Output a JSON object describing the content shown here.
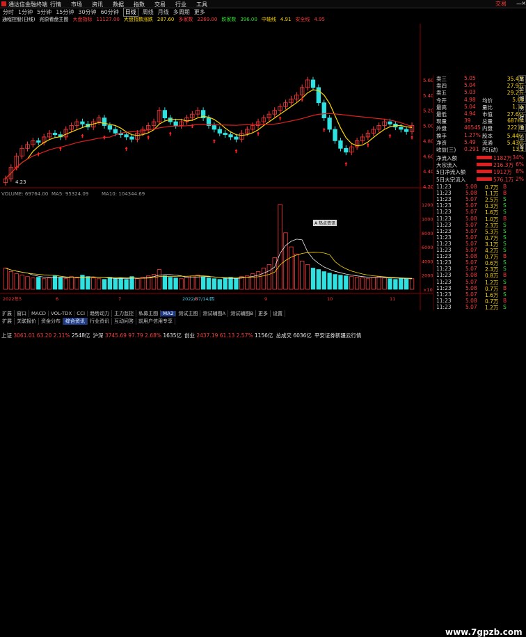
{
  "menubar": {
    "title": "通达信金融终端",
    "menu": [
      "行情",
      "市场",
      "资讯",
      "数据",
      "指数",
      "交易",
      "行业",
      "工具",
      "交易"
    ],
    "trade_label": "交易"
  },
  "toolbar": {
    "periods": [
      "分时",
      "1分钟",
      "5分钟",
      "15分钟",
      "30分钟",
      "60分钟",
      "日线",
      "周线",
      "月线",
      "多周期",
      "更多"
    ],
    "active": "日线"
  },
  "infobar": {
    "stock": "通程控股(日线)",
    "chart_mode": "兆原看盘主图",
    "items": [
      {
        "label": "大盘指标",
        "value": "11127.00",
        "color": "#ff3a3a"
      },
      {
        "label": "大盘指数涨跌",
        "value": "287.60",
        "color": "#ffd800"
      },
      {
        "label": "多家数",
        "value": "2269.00",
        "color": "#ff3a3a"
      },
      {
        "label": "跌家数",
        "value": "396.00",
        "color": "#2ee22e"
      },
      {
        "label": "中轴线",
        "value": "4.91",
        "color": "#ffd800"
      },
      {
        "label": "安全线",
        "value": "4.95",
        "color": "#ff3a3a"
      }
    ]
  },
  "price_axis": {
    "ticks": [
      "5.60",
      "5.40",
      "5.20",
      "5.00",
      "4.80",
      "4.60",
      "4.40",
      "4.20"
    ]
  },
  "volume_header": {
    "volume": "VOLUME: 69764.00",
    "ma5": "MA5: 95324.09",
    "ma10": "MA10: 104344.69"
  },
  "volume_axis": {
    "ticks": [
      "12000",
      "10000",
      "8000",
      "6000",
      "4000",
      "2000"
    ],
    "unit": "×10"
  },
  "low_label": "4.23",
  "tooltip": "A 热点资讯",
  "date_axis": {
    "labels": [
      "2022年5",
      "6",
      "7",
      "2022/07/14/四",
      "8",
      "9",
      "10",
      "11"
    ]
  },
  "quote_panel": {
    "rows": [
      {
        "k": "卖三",
        "v": "5.05",
        "v2": "35.4万"
      },
      {
        "k": "卖四",
        "v": "5.04",
        "v2": "27.9万"
      },
      {
        "k": "卖五",
        "v": "5.03",
        "v2": "29.2万"
      },
      {
        "k": "今开",
        "v": "4.98",
        "k2": "均价",
        "v2": "5.01"
      },
      {
        "k": "最高",
        "v": "5.04",
        "k2": "量比",
        "v2": "1.15"
      },
      {
        "k": "最低",
        "v": "4.94",
        "k2": "市值",
        "v2": "27.6亿"
      },
      {
        "k": "现量",
        "v": "39",
        "k2": "总量",
        "v2": "68764"
      },
      {
        "k": "外盘",
        "v": "46545",
        "k2": "内盘",
        "v2": "22219"
      },
      {
        "k": "换手",
        "v": "1.27%",
        "k2": "股本",
        "v2": "5.44亿"
      },
      {
        "k": "净资",
        "v": "5.49",
        "k2": "流通",
        "v2": "5.43亿"
      },
      {
        "k": "收益(三)",
        "v": "0.291",
        "k2": "PE(动)",
        "v2": "13.1"
      }
    ],
    "flows": [
      {
        "k": "净流入额",
        "v": "1182万",
        "p": "34%"
      },
      {
        "k": "大宗流入",
        "v": "216.3万",
        "p": "6%"
      },
      {
        "k": "5日净流入额",
        "v": "1912万",
        "p": "8%"
      },
      {
        "k": "5日大宗流入",
        "v": "576.1万",
        "p": "2%"
      }
    ]
  },
  "ticks": [
    {
      "t": "11:23",
      "p": "5.08",
      "v": "0.7万",
      "bs": "B"
    },
    {
      "t": "11:23",
      "p": "5.08",
      "v": "1.1万",
      "bs": "B"
    },
    {
      "t": "11:23",
      "p": "5.07",
      "v": "2.5万",
      "bs": "S"
    },
    {
      "t": "11:23",
      "p": "5.07",
      "v": "0.3万",
      "bs": "S"
    },
    {
      "t": "11:23",
      "p": "5.07",
      "v": "1.6万",
      "bs": "S"
    },
    {
      "t": "11:23",
      "p": "5.08",
      "v": "1.0万",
      "bs": "B"
    },
    {
      "t": "11:23",
      "p": "5.07",
      "v": "2.3万",
      "bs": "S"
    },
    {
      "t": "11:23",
      "p": "5.07",
      "v": "5.3万",
      "bs": "S"
    },
    {
      "t": "11:23",
      "p": "5.07",
      "v": "0.7万",
      "bs": "S"
    },
    {
      "t": "11:23",
      "p": "5.07",
      "v": "3.1万",
      "bs": "S"
    },
    {
      "t": "11:23",
      "p": "5.07",
      "v": "4.2万",
      "bs": "S"
    },
    {
      "t": "11:23",
      "p": "5.08",
      "v": "0.7万",
      "bs": "B"
    },
    {
      "t": "11:23",
      "p": "5.07",
      "v": "0.6万",
      "bs": "S"
    },
    {
      "t": "11:23",
      "p": "5.07",
      "v": "2.3万",
      "bs": "S"
    },
    {
      "t": "11:23",
      "p": "5.08",
      "v": "0.8万",
      "bs": "B"
    },
    {
      "t": "11:23",
      "p": "5.07",
      "v": "1.2万",
      "bs": "S"
    },
    {
      "t": "11:23",
      "p": "5.08",
      "v": "0.7万",
      "bs": "B"
    },
    {
      "t": "11:23",
      "p": "5.07",
      "v": "1.6万",
      "bs": "S"
    },
    {
      "t": "11:23",
      "p": "5.08",
      "v": "0.7万",
      "bs": "B"
    },
    {
      "t": "11:23",
      "p": "5.07",
      "v": "1.2万",
      "bs": "S"
    }
  ],
  "tabs1": [
    "扩展",
    "窗口",
    "MACD",
    "VOL-TDX",
    "CCI",
    "趋势动力",
    "主力监控",
    "私募主图",
    "MA2",
    "测试主图",
    "测试辅图A",
    "测试辅图B",
    "更多",
    "设置"
  ],
  "tabs1_active": "MA2",
  "tabs2": [
    "扩展",
    "关联报价",
    "资金分布",
    "综合资讯",
    "行业资讯",
    "互动问答",
    "前用户信用专享"
  ],
  "tabs2_active": "综合资讯",
  "right_tabs": [
    "笔",
    "价",
    "细",
    "势",
    "联",
    "值",
    "主",
    "筹"
  ],
  "index_bar": [
    {
      "n": "上证",
      "p": "3061.01",
      "c": "63.20",
      "r": "2.11%",
      "a": "2548亿"
    },
    {
      "n": "沪深",
      "p": "3745.69",
      "c": "97.79",
      "r": "2.68%",
      "a": "1635亿"
    },
    {
      "n": "创业",
      "p": "2437.19",
      "c": "61.13",
      "r": "2.57%",
      "a": "1156亿"
    }
  ],
  "total_label": "总成交",
  "total_value": "6036亿",
  "news_label": "平安证券新疆云行情",
  "watermark": "www.7gpzb.com",
  "colors": {
    "up": "#ff3a3a",
    "down": "#2ee2e2",
    "ma_yellow": "#ffd800",
    "ma_red": "#e02020",
    "bg": "#000000"
  },
  "chart_data": {
    "type": "candlestick",
    "x_range": [
      "2022-05",
      "2022-11"
    ],
    "price_range": [
      4.2,
      5.7
    ],
    "volume_range": [
      0,
      13000
    ],
    "closes": [
      4.3,
      4.45,
      4.6,
      4.7,
      4.75,
      4.8,
      4.78,
      4.85,
      4.9,
      4.88,
      4.85,
      4.95,
      5.0,
      5.05,
      5.02,
      4.98,
      5.05,
      5.1,
      5.0,
      4.95,
      4.9,
      4.88,
      4.85,
      4.82,
      4.9,
      4.95,
      5.0,
      5.05,
      5.2,
      5.1,
      5.05,
      5.0,
      5.05,
      5.1,
      5.15,
      5.2,
      5.1,
      5.0,
      4.95,
      4.9,
      4.88,
      4.85,
      4.82,
      4.9,
      4.95,
      5.0,
      5.05,
      5.1,
      5.15,
      5.2,
      5.25,
      5.3,
      5.35,
      5.4,
      5.5,
      5.6,
      5.5,
      5.3,
      5.1,
      4.95,
      4.8,
      4.7,
      4.65,
      4.72,
      4.8,
      4.85,
      4.9,
      4.95,
      5.0,
      5.05,
      5.02,
      4.98,
      4.95,
      4.92,
      5.0
    ],
    "volumes": [
      3000,
      2500,
      2200,
      2000,
      1800,
      1600,
      1700,
      1500,
      1600,
      1900,
      1700,
      1500,
      1800,
      1600,
      2000,
      1800,
      1600,
      1500,
      1400,
      1700,
      1500,
      1600,
      1400,
      1800,
      1500,
      1700,
      1900,
      2100,
      2800,
      1900,
      1700,
      1600,
      1500,
      1700,
      1900,
      2000,
      1800,
      1600,
      1500,
      1400,
      1600,
      1700,
      1500,
      1800,
      1900,
      2200,
      2500,
      3000,
      3500,
      4500,
      12000,
      8000,
      6000,
      5000,
      4000,
      3500,
      3000,
      2800,
      2500,
      2300,
      2100,
      2000,
      1900,
      1800,
      1700,
      1600,
      1500,
      1700,
      1800,
      1600,
      1500,
      1400,
      1600,
      1500,
      1500
    ]
  }
}
